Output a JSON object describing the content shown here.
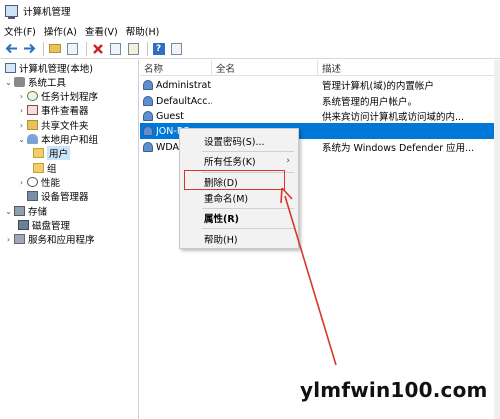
{
  "window": {
    "title": "计算机管理"
  },
  "menu": [
    "文件(F)",
    "操作(A)",
    "查看(V)",
    "帮助(H)"
  ],
  "toolbar": {
    "icons": [
      "back-arrow-icon",
      "forward-arrow-icon",
      "up-folder-icon",
      "show-tree-icon",
      "delete-icon",
      "properties-icon",
      "export-icon",
      "help-icon",
      "console-icon"
    ]
  },
  "tree": {
    "root": "计算机管理(本地)",
    "system_tools": "系统工具",
    "task_scheduler": "任务计划程序",
    "event_viewer": "事件查看器",
    "shared_folders": "共享文件夹",
    "local_users_groups": "本地用户和组",
    "users": "用户",
    "groups": "组",
    "performance": "性能",
    "device_manager": "设备管理器",
    "storage": "存储",
    "disk_management": "磁盘管理",
    "services_apps": "服务和应用程序"
  },
  "list": {
    "columns": {
      "name": "名称",
      "fullname": "全名",
      "description": "描述"
    },
    "rows": [
      {
        "name": "Administrat...",
        "description": "管理计算机(域)的内置帐户"
      },
      {
        "name": "DefaultAcc...",
        "description": "系统管理的用户帐户。"
      },
      {
        "name": "Guest",
        "description": "供来宾访问计算机或访问域的内..."
      },
      {
        "name": "JON-PC",
        "description": ""
      },
      {
        "name": "WDAG...",
        "description": "系统为 Windows Defender 应用..."
      }
    ]
  },
  "context_menu": {
    "set_password": "设置密码(S)...",
    "all_tasks": "所有任务(K)",
    "submenu_arrow": "›",
    "delete": "删除(D)",
    "rename": "重命名(M)",
    "properties": "属性(R)",
    "help": "帮助(H)"
  },
  "annotation": {
    "highlight_color": "#d9362b",
    "arrow_color": "#d9362b"
  },
  "watermark": "ylmfwin100.com"
}
